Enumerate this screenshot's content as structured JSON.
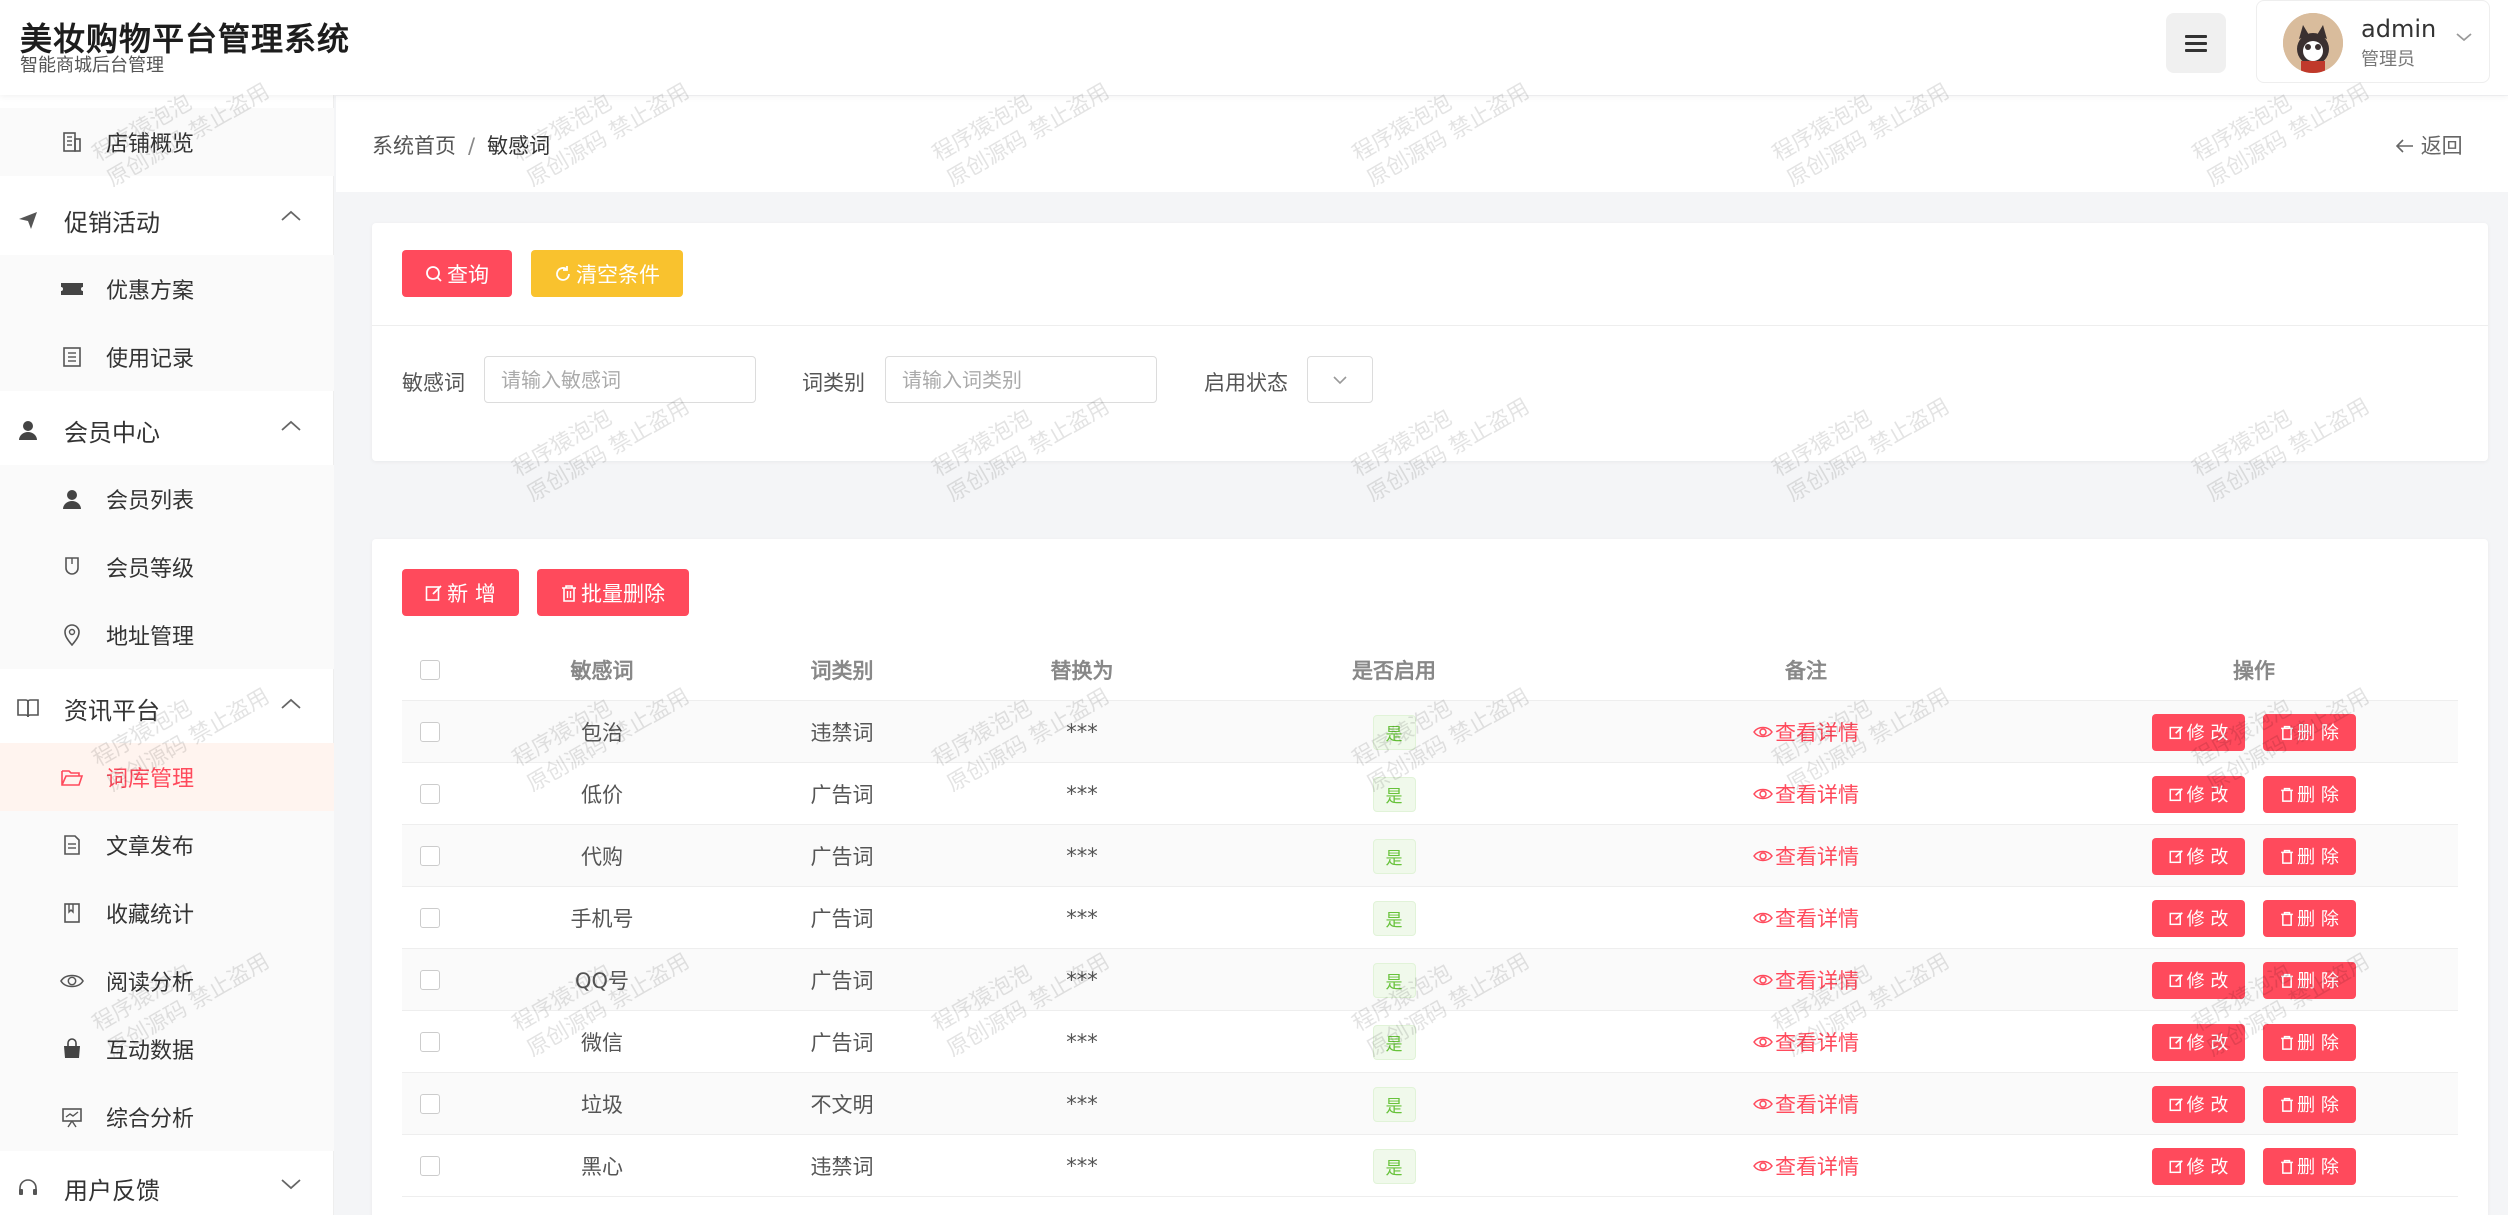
{
  "header": {
    "title": "美妆购物平台管理系统",
    "subtitle": "智能商城后台管理",
    "user": {
      "name": "admin",
      "role": "管理员"
    }
  },
  "sidebar": {
    "items": [
      {
        "type": "sub",
        "label": "店铺概览",
        "icon": "building-icon"
      },
      {
        "type": "group",
        "label": "促销活动",
        "icon": "paper-plane-icon",
        "expanded": true
      },
      {
        "type": "sub",
        "label": "优惠方案",
        "icon": "ticket-icon"
      },
      {
        "type": "sub",
        "label": "使用记录",
        "icon": "list-icon"
      },
      {
        "type": "group",
        "label": "会员中心",
        "icon": "user-icon",
        "expanded": true
      },
      {
        "type": "sub",
        "label": "会员列表",
        "icon": "user-icon"
      },
      {
        "type": "sub",
        "label": "会员等级",
        "icon": "medal-icon"
      },
      {
        "type": "sub",
        "label": "地址管理",
        "icon": "location-icon"
      },
      {
        "type": "group",
        "label": "资讯平台",
        "icon": "book-icon",
        "expanded": true
      },
      {
        "type": "sub",
        "label": "词库管理",
        "icon": "folder-open-icon",
        "active": true
      },
      {
        "type": "sub",
        "label": "文章发布",
        "icon": "document-icon"
      },
      {
        "type": "sub",
        "label": "收藏统计",
        "icon": "bookmark-icon"
      },
      {
        "type": "sub",
        "label": "阅读分析",
        "icon": "eye-icon"
      },
      {
        "type": "sub",
        "label": "互动数据",
        "icon": "bag-icon"
      },
      {
        "type": "sub",
        "label": "综合分析",
        "icon": "presentation-icon"
      },
      {
        "type": "group",
        "label": "用户反馈",
        "icon": "headset-icon",
        "expanded": false
      }
    ]
  },
  "breadcrumb": {
    "home": "系统首页",
    "separator": "/",
    "current": "敏感词",
    "back": "返回"
  },
  "search": {
    "query_button": "查询",
    "clear_button": "清空条件",
    "fields": {
      "word": {
        "label": "敏感词",
        "placeholder": "请输入敏感词"
      },
      "category": {
        "label": "词类别",
        "placeholder": "请输入词类别"
      },
      "status": {
        "label": "启用状态"
      }
    }
  },
  "toolbar": {
    "add_button": "新 增",
    "batch_delete_button": "批量删除"
  },
  "table": {
    "columns": [
      "敏感词",
      "词类别",
      "替换为",
      "是否启用",
      "备注",
      "操作"
    ],
    "detail_label": "查看详情",
    "edit_label": "修 改",
    "delete_label": "删 除",
    "rows": [
      {
        "word": "包治",
        "category": "违禁词",
        "replace": "***",
        "enabled": "是"
      },
      {
        "word": "低价",
        "category": "广告词",
        "replace": "***",
        "enabled": "是"
      },
      {
        "word": "代购",
        "category": "广告词",
        "replace": "***",
        "enabled": "是"
      },
      {
        "word": "手机号",
        "category": "广告词",
        "replace": "***",
        "enabled": "是"
      },
      {
        "word": "QQ号",
        "category": "广告词",
        "replace": "***",
        "enabled": "是"
      },
      {
        "word": "微信",
        "category": "广告词",
        "replace": "***",
        "enabled": "是"
      },
      {
        "word": "垃圾",
        "category": "不文明",
        "replace": "***",
        "enabled": "是"
      },
      {
        "word": "黑心",
        "category": "违禁词",
        "replace": "***",
        "enabled": "是"
      }
    ]
  },
  "watermark": {
    "line1": "程序猿泡泡",
    "line2": "原创源码 禁止盗用"
  },
  "colors": {
    "primary": "#ff4a5c",
    "warning": "#f9c22e",
    "success": "#67c23a"
  }
}
